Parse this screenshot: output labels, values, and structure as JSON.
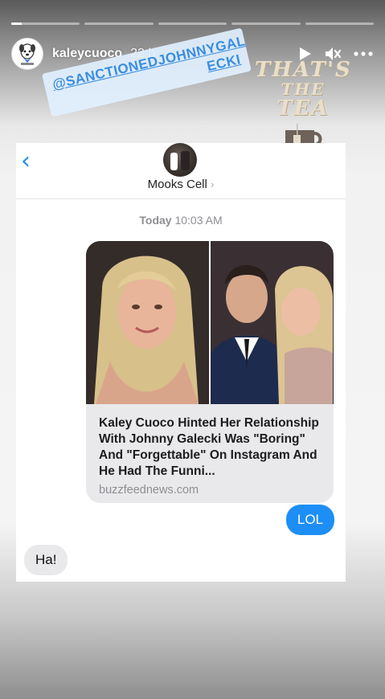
{
  "story": {
    "progress": [
      0.15,
      0,
      0,
      0,
      0
    ],
    "username": "kaleycuoco",
    "time": "22 h",
    "icons": [
      "play-icon",
      "mute-icon",
      "more-icon"
    ]
  },
  "stickers": {
    "mention_line1": "@SANCTIONEDJOHNNYGAL",
    "mention_line2": "ECKI",
    "tea_line1": "THAT'S",
    "tea_line2": "THE",
    "tea_line3": "TEA"
  },
  "messages": {
    "contact_name": "Mooks Cell",
    "timestamp_day": "Today",
    "timestamp_time": "10:03 AM",
    "link_title": "Kaley Cuoco Hinted Her Relationship With Johnny Galecki Was \"Boring\" And \"Forgettable\" On Instagram And He Had The Funni...",
    "link_domain": "buzzfeednews.com",
    "outgoing": "LOL",
    "incoming": "Ha!"
  },
  "colors": {
    "imessage_blue": "#1d8ef6",
    "bubble_gray": "#e9e9eb",
    "mention_blue": "#3a8de0"
  }
}
